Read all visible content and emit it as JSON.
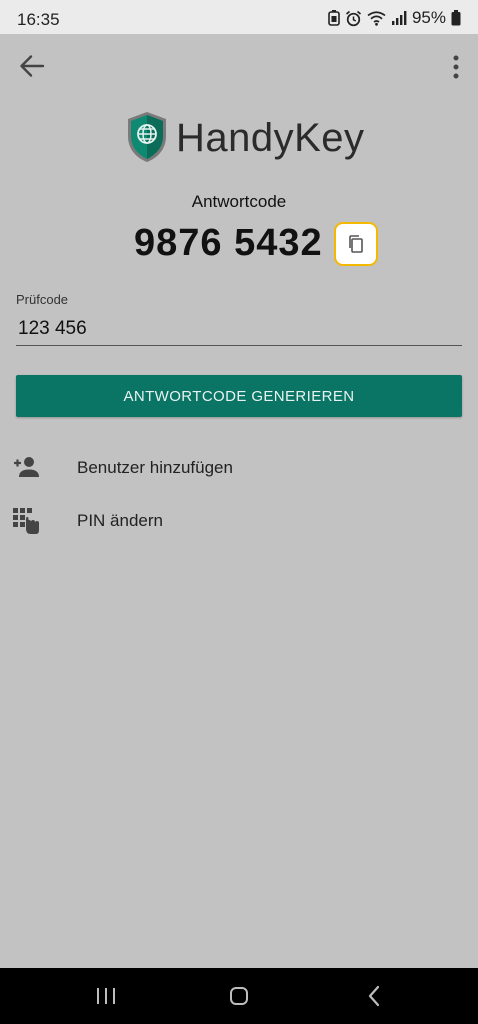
{
  "status_bar": {
    "time": "16:35",
    "battery": "95%",
    "icons": [
      "battery-saver-icon",
      "alarm-icon",
      "wifi-icon",
      "signal-icon",
      "battery-icon"
    ]
  },
  "toolbar": {
    "back_icon": "arrow-left-icon",
    "menu_icon": "more-vert-icon"
  },
  "brand": {
    "name": "HandyKey",
    "logo_icon": "shield-globe-icon"
  },
  "answer": {
    "label": "Antwortcode",
    "code": "9876 5432",
    "copy_icon": "copy-icon"
  },
  "check_field": {
    "label": "Prüfcode",
    "value": "123 456"
  },
  "generate_button": {
    "label": "ANTWORTCODE GENERIEREN"
  },
  "menu_items": [
    {
      "label": "Benutzer hinzufügen",
      "icon": "person-add-icon"
    },
    {
      "label": "PIN ändern",
      "icon": "pin-keypad-icon"
    }
  ],
  "colors": {
    "background": "#c2c2c2",
    "status_bar": "#ebebeb",
    "primary": "#0a7465",
    "copy_border": "#f5b800",
    "nav_bar": "#000000"
  },
  "nav_bar": {
    "icons": [
      "recents-icon",
      "home-icon",
      "back-nav-icon"
    ]
  }
}
